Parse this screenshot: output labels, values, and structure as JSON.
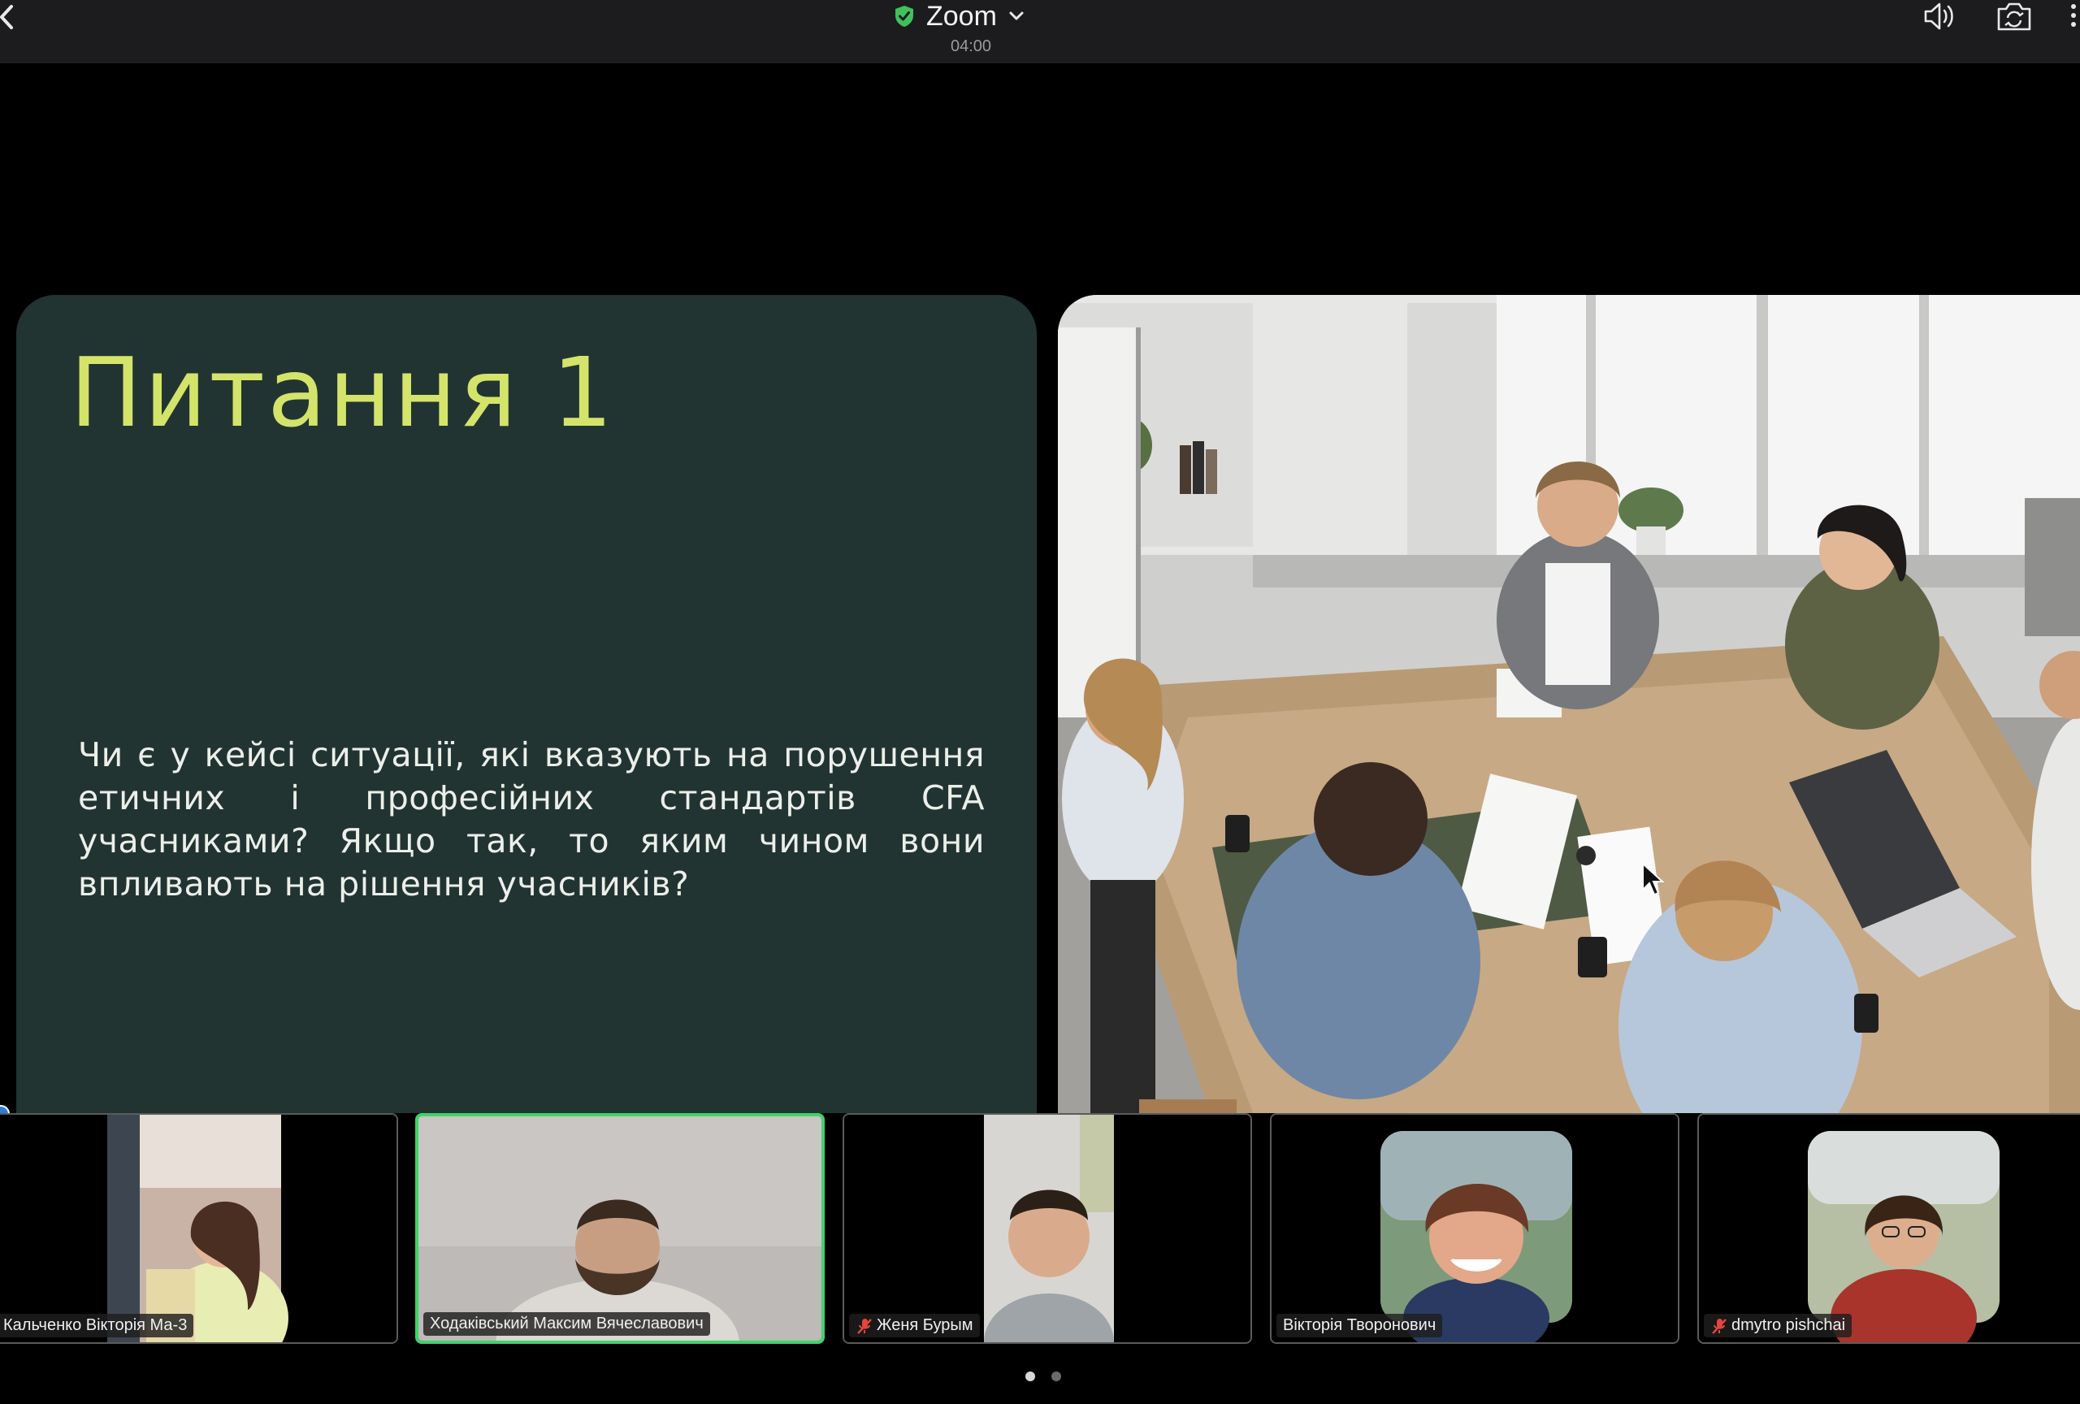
{
  "window": {
    "app_title": "Zoom",
    "timer": "04:00"
  },
  "icons": {
    "back": "chevron-left-icon",
    "shield": "verified-shield-icon",
    "title_dropdown": "chevron-down-icon",
    "speaker": "speaker-icon",
    "camera_switch": "camera-switch-icon",
    "more": "more-vertical-icon"
  },
  "slide": {
    "heading": "Питання 1",
    "body": "Чи є у кейсі ситуації, які вказують на порушення етичних і професійних стандартів CFA учасниками? Якщо так, то яким чином вони впливають на рішення учасників?"
  },
  "participants": [
    {
      "name": "Кальченко Вікторія Ма-3",
      "muted": false,
      "active": false
    },
    {
      "name": "Ходаківський Максим Вячеславович",
      "muted": false,
      "active": true
    },
    {
      "name": "Женя Бурым",
      "muted": true,
      "active": false
    },
    {
      "name": "Вікторія Творонович",
      "muted": false,
      "active": false
    },
    {
      "name": "dmytro pishchai",
      "muted": true,
      "active": false
    }
  ],
  "pagination": {
    "pages": 2,
    "current": 1
  },
  "colors": {
    "accent_active": "#3fd36b",
    "slide_bg": "#223432",
    "heading": "#d4e46a",
    "mic_muted": "#e5453a",
    "shield": "#3fc15b"
  }
}
